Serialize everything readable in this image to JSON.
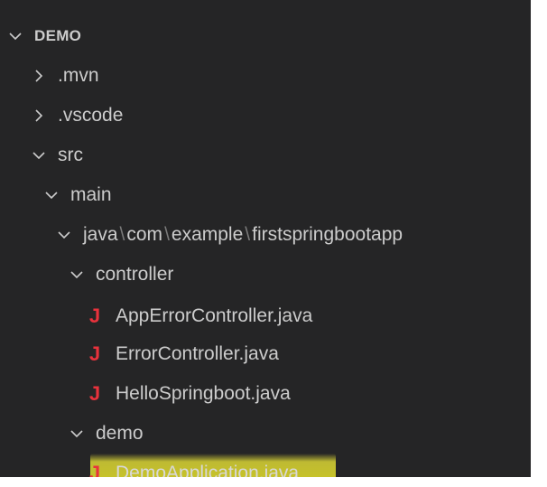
{
  "explorer": {
    "root": {
      "label": "DEMO",
      "icon": "chevron-down-icon",
      "expanded": true
    },
    "items": [
      {
        "label": ".mvn",
        "icon": "chevron-right-icon",
        "expanded": false
      },
      {
        "label": ".vscode",
        "icon": "chevron-right-icon",
        "expanded": false
      },
      {
        "label": "src",
        "icon": "chevron-down-icon",
        "expanded": true
      },
      {
        "label": "main",
        "icon": "chevron-down-icon",
        "expanded": true
      },
      {
        "path_parts": [
          "java",
          "com",
          "example",
          "firstspringbootapp"
        ],
        "separator": "\\",
        "icon": "chevron-down-icon",
        "expanded": true
      },
      {
        "label": "controller",
        "icon": "chevron-down-icon",
        "expanded": true
      },
      {
        "label": "AppErrorController.java",
        "icon": "java-file-icon",
        "glyph": "J"
      },
      {
        "label": "ErrorController.java",
        "icon": "java-file-icon",
        "glyph": "J"
      },
      {
        "label": "HelloSpringboot.java",
        "icon": "java-file-icon",
        "glyph": "J"
      },
      {
        "label": "demo",
        "icon": "chevron-down-icon",
        "expanded": true
      },
      {
        "label": "DemoApplication.java",
        "icon": "java-file-icon",
        "glyph": "J",
        "highlighted": true
      }
    ]
  },
  "colors": {
    "panel_background": "#252526",
    "text": "#cccccc",
    "java_icon": "#e8323c",
    "highlight": "#f2ec37",
    "separator": "#7a7a7a"
  }
}
